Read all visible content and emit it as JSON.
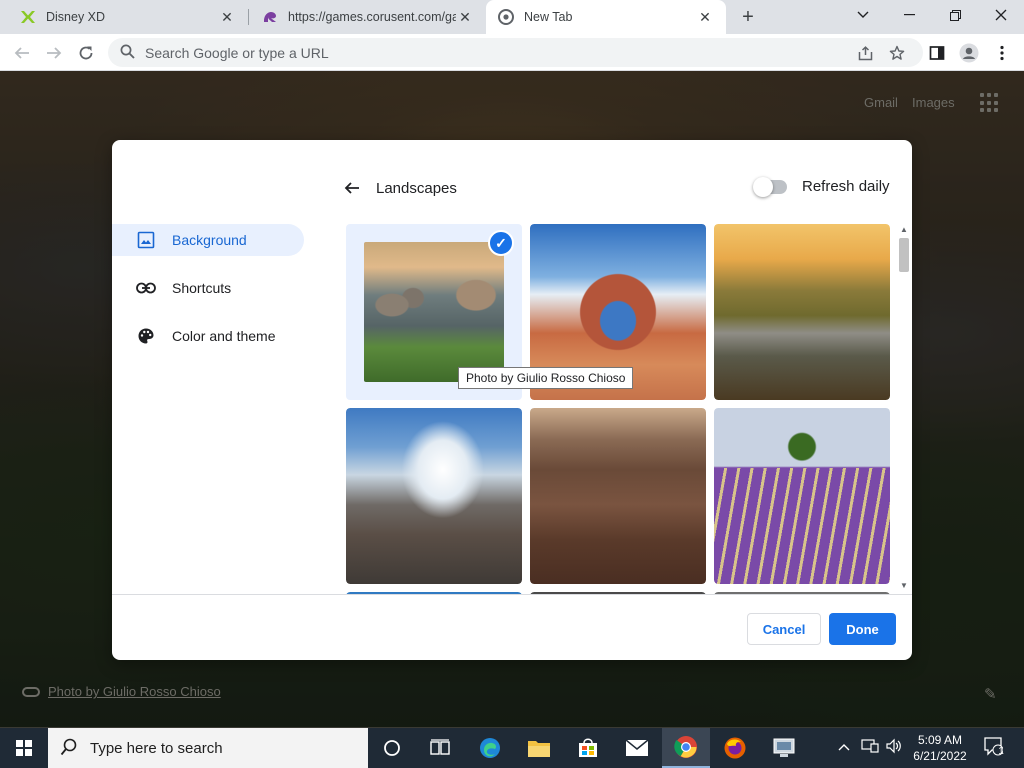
{
  "browser": {
    "tabs": [
      {
        "title": "Disney XD",
        "favicon": "disney-xd-favicon",
        "active": false
      },
      {
        "title": "https://games.corusent.com/gam",
        "favicon": "corus-favicon",
        "active": false
      },
      {
        "title": "New Tab",
        "favicon": "chrome-favicon",
        "active": true
      }
    ],
    "omnibox_placeholder": "Search Google or type a URL"
  },
  "ntp": {
    "gmail_label": "Gmail",
    "images_label": "Images",
    "attribution": "Photo by Giulio Rosso Chioso"
  },
  "dialog": {
    "sidebar": [
      {
        "label": "Background",
        "icon": "image-icon",
        "selected": true
      },
      {
        "label": "Shortcuts",
        "icon": "link-icon",
        "selected": false
      },
      {
        "label": "Color and theme",
        "icon": "palette-icon",
        "selected": false
      }
    ],
    "collection_title": "Landscapes",
    "refresh_daily_label": "Refresh daily",
    "refresh_daily_on": false,
    "tooltip": "Photo by Giulio Rosso Chioso",
    "images": [
      {
        "desc": "rocky lake at sunset",
        "selected": true
      },
      {
        "desc": "red rock arch under blue sky",
        "selected": false
      },
      {
        "desc": "canyon cliffs at sunrise",
        "selected": false
      },
      {
        "desc": "snowy mountain peak",
        "selected": false
      },
      {
        "desc": "desert canyon with winding road",
        "selected": false
      },
      {
        "desc": "lavender field with tree",
        "selected": false
      }
    ],
    "cancel_label": "Cancel",
    "done_label": "Done",
    "accent_color": "#1a73e8"
  },
  "taskbar": {
    "search_placeholder": "Type here to search",
    "time": "5:09 AM",
    "date": "6/21/2022",
    "notification_count": "1"
  }
}
